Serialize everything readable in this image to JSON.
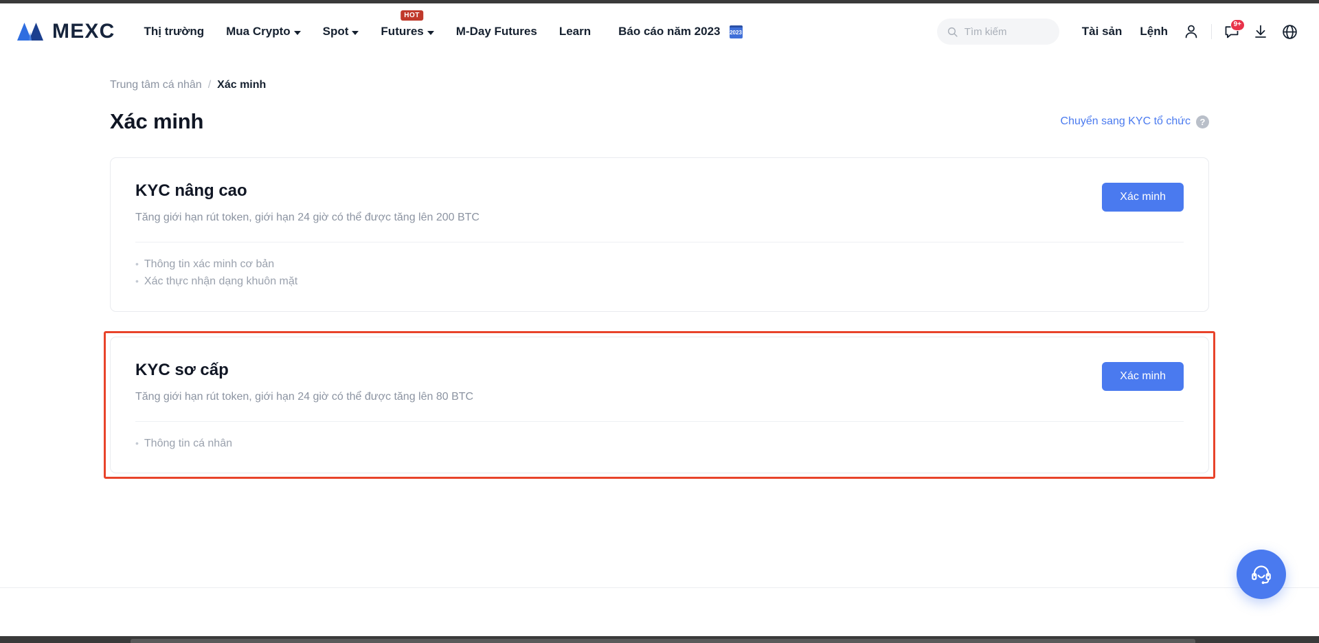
{
  "header": {
    "logo_text": "MEXC",
    "nav": [
      {
        "label": "Thị trường",
        "has_caret": false,
        "badge": ""
      },
      {
        "label": "Mua Crypto",
        "has_caret": true,
        "badge": ""
      },
      {
        "label": "Spot",
        "has_caret": true,
        "badge": ""
      },
      {
        "label": "Futures",
        "has_caret": true,
        "badge": "HOT"
      },
      {
        "label": "M-Day Futures",
        "has_caret": false,
        "badge": ""
      },
      {
        "label": "Learn",
        "has_caret": false,
        "badge": ""
      }
    ],
    "report_link": "Báo cáo năm 2023",
    "report_year": "2023",
    "search_placeholder": "Tìm kiếm",
    "search_value": "",
    "assets_label": "Tài sản",
    "orders_label": "Lệnh",
    "message_badge": "9+"
  },
  "breadcrumb": {
    "parent": "Trung tâm cá nhân",
    "separator": "/",
    "current": "Xác minh"
  },
  "main": {
    "title": "Xác minh",
    "switch_kyc_label": "Chuyển sang KYC tổ chức",
    "help_glyph": "?",
    "cards": [
      {
        "title": "KYC nâng cao",
        "subtitle": "Tăng giới hạn rút token, giới hạn 24 giờ có thể được tăng lên 200 BTC",
        "button_label": "Xác minh",
        "requirements": [
          "Thông tin xác minh cơ bản",
          "Xác thực nhận dạng khuôn mặt"
        ],
        "highlighted": false
      },
      {
        "title": "KYC sơ cấp",
        "subtitle": "Tăng giới hạn rút token, giới hạn 24 giờ có thể được tăng lên 80 BTC",
        "button_label": "Xác minh",
        "requirements": [
          "Thông tin cá nhân"
        ],
        "highlighted": true
      }
    ]
  },
  "colors": {
    "accent_blue": "#4a7aef",
    "highlight_red": "#e8432a",
    "hot_badge_red": "#c0392b",
    "notification_red": "#e8334a",
    "muted_text": "#8b93a1",
    "title_dark": "#101624"
  }
}
